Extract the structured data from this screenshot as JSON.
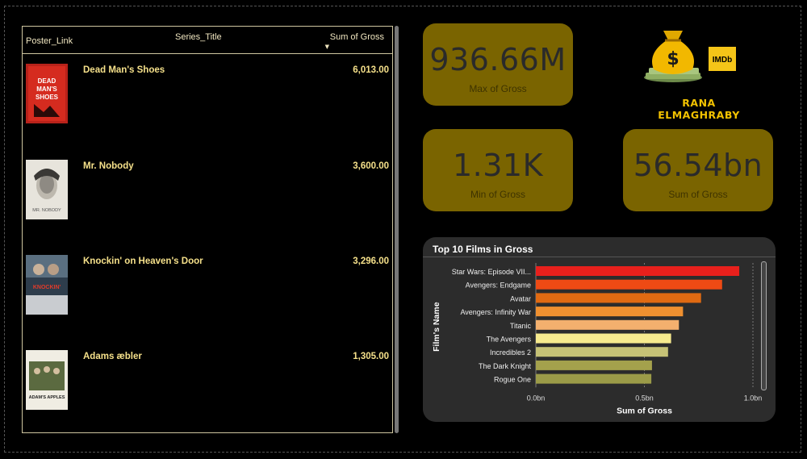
{
  "table": {
    "headers": {
      "poster": "Poster_Link",
      "title": "Series_Title",
      "gross": "Sum of Gross"
    },
    "rows": [
      {
        "title": "Dead Man's Shoes",
        "gross": "6,013.00",
        "poster_text": "DEAD MAN'S SHOES",
        "poster_color": "#c8281e"
      },
      {
        "title": "Mr. Nobody",
        "gross": "3,600.00",
        "poster_text": "MR. NOBODY",
        "poster_color": "#d9d6cf"
      },
      {
        "title": "Knockin' on Heaven's Door",
        "gross": "3,296.00",
        "poster_text": "KNOCKIN' ON HEAVEN'S DOOR",
        "poster_color": "#3b4a5a"
      },
      {
        "title": "Adams æbler",
        "gross": "1,305.00",
        "poster_text": "ADAM'S APPLES",
        "poster_color": "#e8e4d6"
      }
    ]
  },
  "kpis": {
    "max": {
      "value": "936.66M",
      "label": "Max of Gross"
    },
    "min": {
      "value": "1.31K",
      "label": "Min of Gross"
    },
    "sum": {
      "value": "56.54bn",
      "label": "Sum of Gross"
    }
  },
  "logo": {
    "imdb": "IMDb",
    "dollar": "$",
    "caption": "RANA ELMAGHRABY"
  },
  "chart_data": {
    "type": "bar",
    "orientation": "horizontal",
    "title": "Top 10 Films in Gross",
    "xlabel": "Sum of Gross",
    "ylabel": "Film's Name",
    "xlim": [
      0,
      1.0
    ],
    "x_unit": "bn",
    "xticks": [
      "0.0bn",
      "0.5bn",
      "1.0bn"
    ],
    "xtick_values": [
      0,
      0.5,
      1.0
    ],
    "grid": true,
    "categories": [
      "Star Wars: Episode VII...",
      "Avengers: Endgame",
      "Avatar",
      "Avengers: Infinity War",
      "Titanic",
      "The Avengers",
      "Incredibles 2",
      "The Dark Knight",
      "Rogue One"
    ],
    "values": [
      0.937,
      0.858,
      0.761,
      0.678,
      0.659,
      0.623,
      0.609,
      0.535,
      0.532
    ],
    "colors": [
      "#e8201c",
      "#ee4a14",
      "#e06a12",
      "#ef9030",
      "#f3b06e",
      "#f7eb8e",
      "#c6c276",
      "#a4a14c",
      "#9b9b48"
    ]
  }
}
